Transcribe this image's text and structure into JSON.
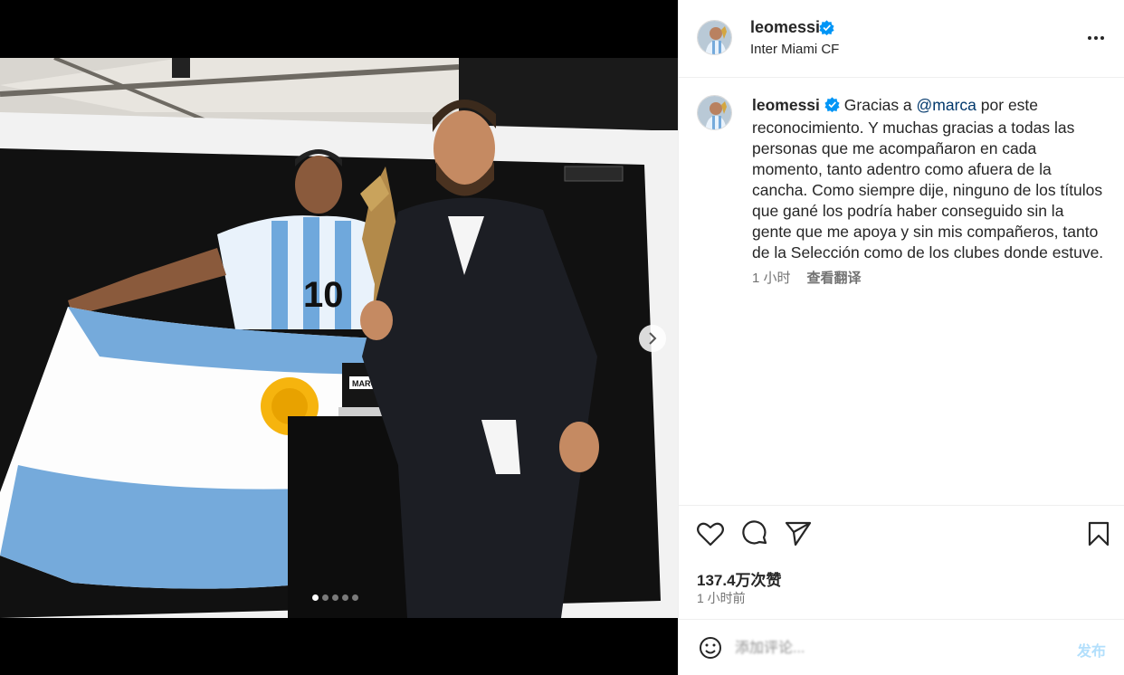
{
  "header": {
    "username": "leomessi",
    "location": "Inter Miami CF"
  },
  "caption": {
    "username": "leomessi",
    "text_before_mention": "Gracias a ",
    "mention": "@marca",
    "text_after_mention": " por este reconocimiento. Y muchas gracias a todas las personas que me acompañaron en cada momento, tanto adentro como afuera de la cancha. Como siempre dije, ninguno de los títulos que gané los podría haber conseguido sin la gente que me apoya y sin mis compañeros, tanto de la Selección como de los clubes donde estuve.",
    "age": "1 小时",
    "translate_label": "查看翻译"
  },
  "media": {
    "trophy_plate_text": "MARCA",
    "jersey_number": "10",
    "carousel_total": 5,
    "carousel_active": 1
  },
  "actions": {
    "icons": [
      "heart-icon",
      "comment-icon",
      "share-icon",
      "bookmark-icon"
    ],
    "likes_label": "137.4万次赞",
    "time_label": "1 小时前"
  },
  "comment": {
    "placeholder": "添加评论...",
    "post_label": "发布"
  },
  "colors": {
    "verified_blue": "#0095f6",
    "mention": "#00376b",
    "muted_text": "#737373",
    "post_disabled": "#b2dffc"
  }
}
